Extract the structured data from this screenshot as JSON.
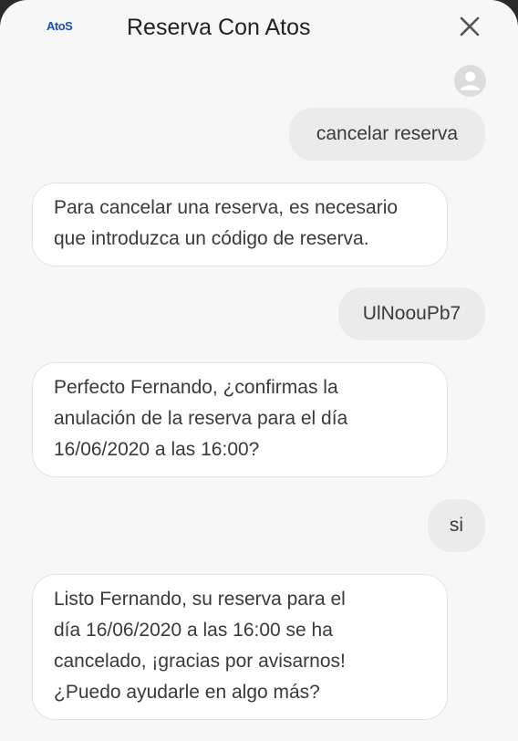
{
  "header": {
    "logo_text": "AtoS",
    "title": "Reserva Con Atos",
    "close_icon": "close-icon"
  },
  "user_avatar_icon": "user-avatar-icon",
  "messages": [
    {
      "sender": "user",
      "lines": [
        "cancelar reserva"
      ]
    },
    {
      "sender": "bot",
      "lines": [
        "Para cancelar una reserva, es necesario",
        "que introduzca un código de reserva."
      ]
    },
    {
      "sender": "user",
      "lines": [
        "UlNoouPb7"
      ]
    },
    {
      "sender": "bot",
      "lines": [
        "Perfecto Fernando, ¿confirmas la",
        "anulación de la reserva para el día",
        "16/06/2020 a las 16:00?"
      ]
    },
    {
      "sender": "user",
      "lines": [
        "si"
      ]
    },
    {
      "sender": "bot",
      "lines": [
        "Listo Fernando, su reserva para el",
        "día 16/06/2020 a las 16:00 se ha",
        "cancelado, ¡gracias por avisarnos!",
        "¿Puedo ayudarle en algo más?"
      ]
    }
  ],
  "colors": {
    "brand": "#1e4fa8",
    "background": "#f7f7f7",
    "user_bubble": "#ebebeb",
    "bot_bubble": "#ffffff"
  }
}
